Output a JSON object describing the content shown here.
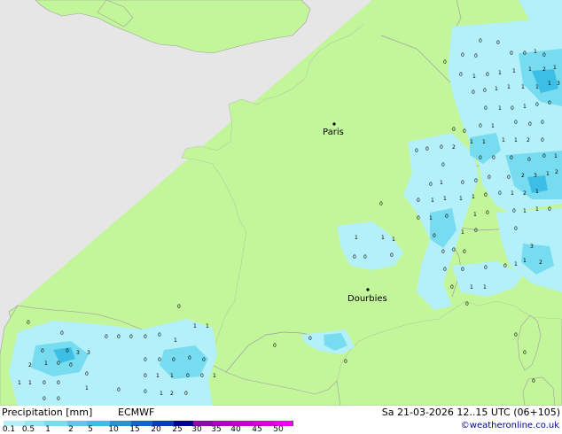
{
  "map": {
    "colors": {
      "sea": "#e6e6e6",
      "land": "#c3f59b",
      "border": "#a0a0a0",
      "precip_light": "#b4f0fa",
      "precip_medium": "#78dcf0",
      "precip_heavy": "#3cbee6"
    },
    "cities": [
      {
        "name": "Paris"
      },
      {
        "name": "Dourbies"
      }
    ]
  },
  "footer": {
    "title": "Precipitation [mm]",
    "model": "ECMWF",
    "datetime": "Sa 21-03-2026 12..15 UTC (06+105)",
    "credit": "©weatheronline.co.uk",
    "legend": {
      "ticks": [
        "0.1",
        "0.5",
        "1",
        "2",
        "5",
        "10",
        "15",
        "20",
        "25",
        "30",
        "35",
        "40",
        "45",
        "50"
      ],
      "colors": [
        "#b4f0fa",
        "#96e6f5",
        "#78dcf0",
        "#5ac8eb",
        "#3cbee6",
        "#1e96dc",
        "#1464d2",
        "#0a3cbe",
        "#000096",
        "#9600b4",
        "#b400c8",
        "#c800d2",
        "#dc00dc",
        "#f000f0"
      ]
    }
  }
}
